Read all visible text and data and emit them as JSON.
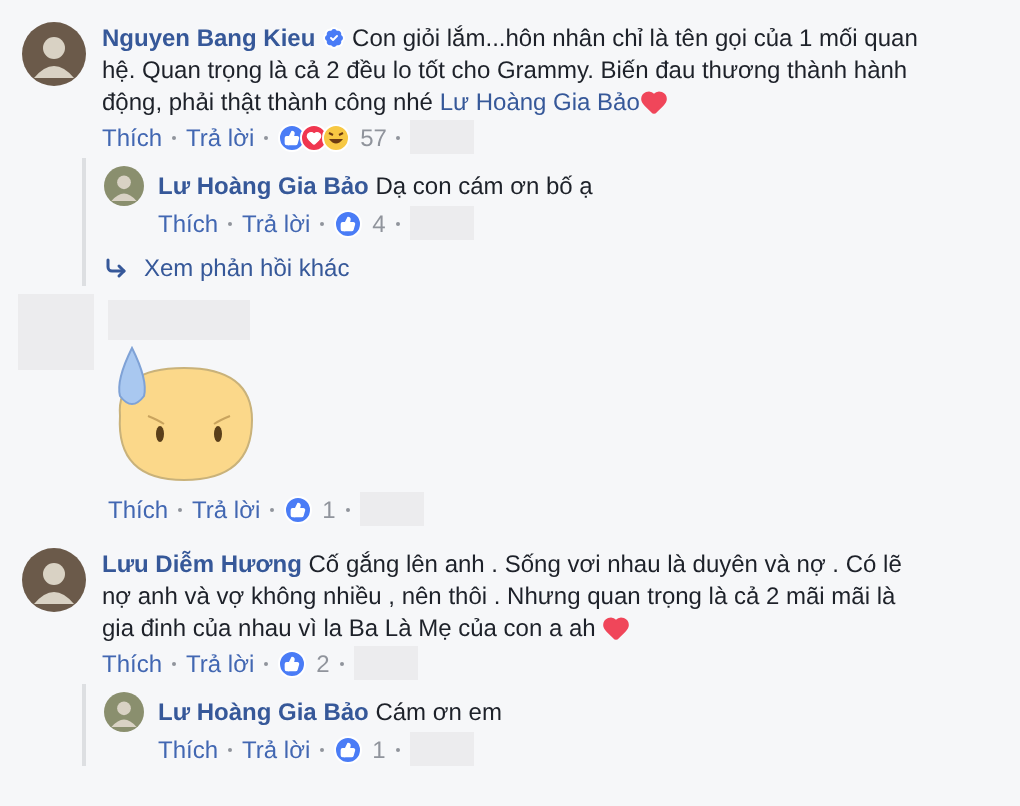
{
  "comments": [
    {
      "kind": "text",
      "author": "Nguyen Bang Kieu",
      "body": [
        {
          "kind": "badge"
        },
        {
          "kind": "text",
          "text": "Con giỏi lắm...hôn nhân chỉ là tên gọi của 1 mối quan hệ. Quan trọng là cả 2 đều lo tốt cho Grammy. Biến đau thương thành hành động, phải thật thành công nhé "
        },
        {
          "kind": "mention",
          "text": "Lư Hoàng Gia Bảo"
        },
        {
          "kind": "heart"
        }
      ],
      "like": "Thích",
      "reply": "Trả lời",
      "reactions": [
        {
          "kind": "like"
        },
        {
          "kind": "love"
        },
        {
          "kind": "haha"
        }
      ],
      "count": "57",
      "replies": [
        {
          "author": "Lư Hoàng Gia Bảo",
          "body": "Dạ con cám ơn bố ạ",
          "like": "Thích",
          "reply": "Trả lời",
          "reactions": [
            {
              "kind": "like"
            }
          ],
          "count": "4"
        }
      ],
      "more_replies": "Xem phản hồi khác"
    },
    {
      "kind": "sticker",
      "like": "Thích",
      "reply": "Trả lời",
      "reactions": [
        {
          "kind": "like"
        }
      ],
      "count": "1"
    },
    {
      "kind": "text",
      "author": "Lưu Diễm Hương",
      "body": [
        {
          "kind": "text",
          "text": "Cố gắng lên anh . Sống vơi nhau là duyên và nợ . Có lẽ nợ anh và vợ không nhiều , nên thôi . Nhưng quan trọng là cả 2 mãi mãi là gia đinh của nhau vì la Ba Là Mẹ của con a ah "
        },
        {
          "kind": "heart"
        }
      ],
      "like": "Thích",
      "reply": "Trả lời",
      "reactions": [
        {
          "kind": "like"
        }
      ],
      "count": "2",
      "replies": [
        {
          "author": "Lư Hoàng Gia Bảo",
          "body": "Cám ơn em",
          "like": "Thích",
          "reply": "Trả lời",
          "reactions": [
            {
              "kind": "like"
            }
          ],
          "count": "1"
        }
      ]
    }
  ]
}
